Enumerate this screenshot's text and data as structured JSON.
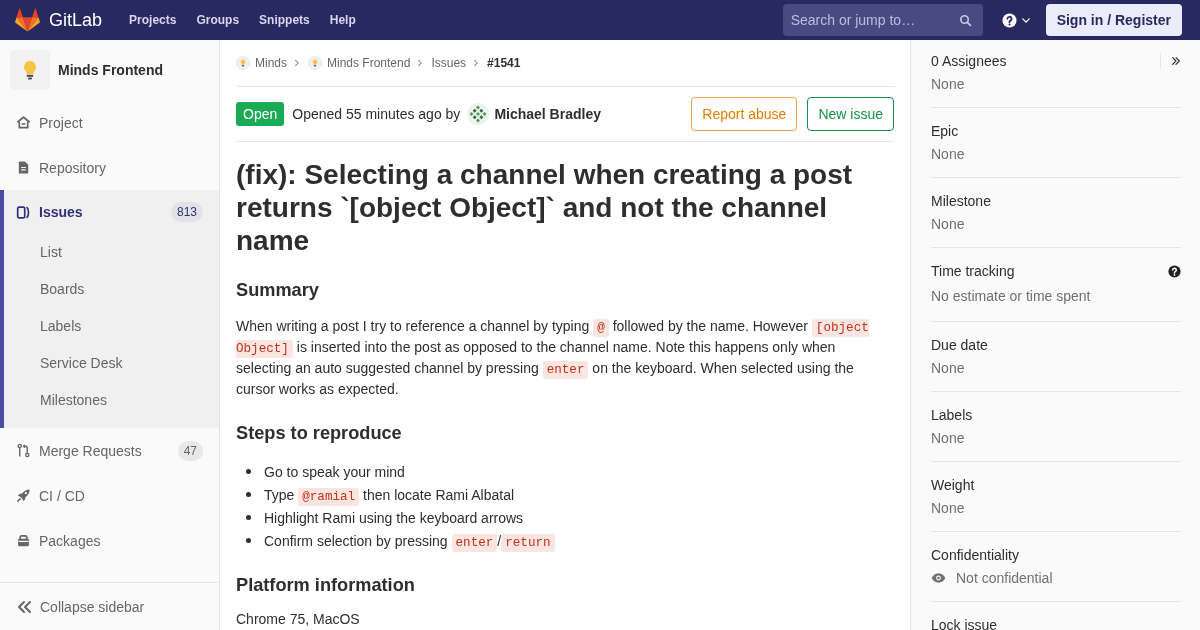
{
  "navbar": {
    "brand": "GitLab",
    "links": [
      {
        "label": "Projects"
      },
      {
        "label": "Groups"
      },
      {
        "label": "Snippets"
      },
      {
        "label": "Help"
      }
    ],
    "search": {
      "placeholder": "Search or jump to…"
    },
    "sign_in": "Sign in / Register"
  },
  "sidebar": {
    "project": "Minds Frontend",
    "items": [
      {
        "label": "Project",
        "selected": false
      },
      {
        "label": "Repository",
        "selected": false
      },
      {
        "label": "Issues",
        "selected": true,
        "count": "813",
        "children": [
          {
            "label": "List",
            "selected": false
          },
          {
            "label": "Boards",
            "selected": false
          },
          {
            "label": "Labels",
            "selected": false
          },
          {
            "label": "Service Desk",
            "selected": false
          },
          {
            "label": "Milestones",
            "selected": false
          }
        ]
      },
      {
        "label": "Merge Requests",
        "selected": false,
        "count": "47"
      },
      {
        "label": "CI / CD",
        "selected": false
      },
      {
        "label": "Packages",
        "selected": false
      }
    ],
    "collapse": "Collapse sidebar"
  },
  "breadcrumbs": [
    {
      "label": "Minds",
      "kind": "group"
    },
    {
      "label": "Minds Frontend",
      "kind": "project"
    },
    {
      "label": "Issues",
      "kind": "link"
    },
    {
      "label": "#1541",
      "kind": "current"
    }
  ],
  "issue": {
    "status": "Open",
    "opened": "Opened 55 minutes ago by",
    "author": "Michael Bradley",
    "actions": [
      {
        "label": "Report abuse",
        "kind": "warning"
      },
      {
        "label": "New issue",
        "kind": "success"
      }
    ],
    "title": "(fix): Selecting a channel when creating a post returns `[object Object]` and not the channel name",
    "body": [
      {
        "kind": "heading",
        "text": "Summary"
      },
      {
        "kind": "paragraph",
        "segments": [
          {
            "kind": "text",
            "text": "When writing a post I try to reference a channel by typing "
          },
          {
            "kind": "code",
            "text": "@"
          },
          {
            "kind": "text",
            "text": " followed by the name. However "
          },
          {
            "kind": "code",
            "text": "[object Object]"
          },
          {
            "kind": "text",
            "text": " is inserted into the post as opposed to the channel name. Note this happens only when selecting an auto suggested channel by pressing "
          },
          {
            "kind": "code",
            "text": "enter"
          },
          {
            "kind": "text",
            "text": " on the keyboard. When selected using the cursor works as expected."
          }
        ]
      },
      {
        "kind": "heading",
        "text": "Steps to reproduce"
      },
      {
        "kind": "list",
        "items": [
          [
            {
              "kind": "text",
              "text": "Go to speak your mind"
            }
          ],
          [
            {
              "kind": "text",
              "text": "Type "
            },
            {
              "kind": "code",
              "text": "@ramial"
            },
            {
              "kind": "text",
              "text": " then locate Rami Albatal"
            }
          ],
          [
            {
              "kind": "text",
              "text": "Highlight Rami using the keyboard arrows"
            }
          ],
          [
            {
              "kind": "text",
              "text": "Confirm selection by pressing "
            },
            {
              "kind": "code",
              "text": "enter"
            },
            {
              "kind": "text",
              "text": "/"
            },
            {
              "kind": "code",
              "text": "return"
            }
          ]
        ]
      },
      {
        "kind": "heading",
        "text": "Platform information"
      },
      {
        "kind": "paragraph",
        "segments": [
          {
            "kind": "text",
            "text": "Chrome 75, MacOS"
          }
        ]
      }
    ]
  },
  "right_sidebar": {
    "blocks": [
      {
        "kind": "assignees",
        "title": "0 Assignees",
        "value": "None"
      },
      {
        "kind": "plain",
        "title": "Epic",
        "value": "None"
      },
      {
        "kind": "plain",
        "title": "Milestone",
        "value": "None"
      },
      {
        "kind": "help",
        "title": "Time tracking",
        "value": "No estimate or time spent"
      },
      {
        "kind": "plain",
        "title": "Due date",
        "value": "None"
      },
      {
        "kind": "plain",
        "title": "Labels",
        "value": "None"
      },
      {
        "kind": "plain",
        "title": "Weight",
        "value": "None"
      },
      {
        "kind": "confidentiality",
        "title": "Confidentiality",
        "value": "Not confidential"
      },
      {
        "kind": "plain",
        "title": "Lock issue"
      }
    ]
  }
}
